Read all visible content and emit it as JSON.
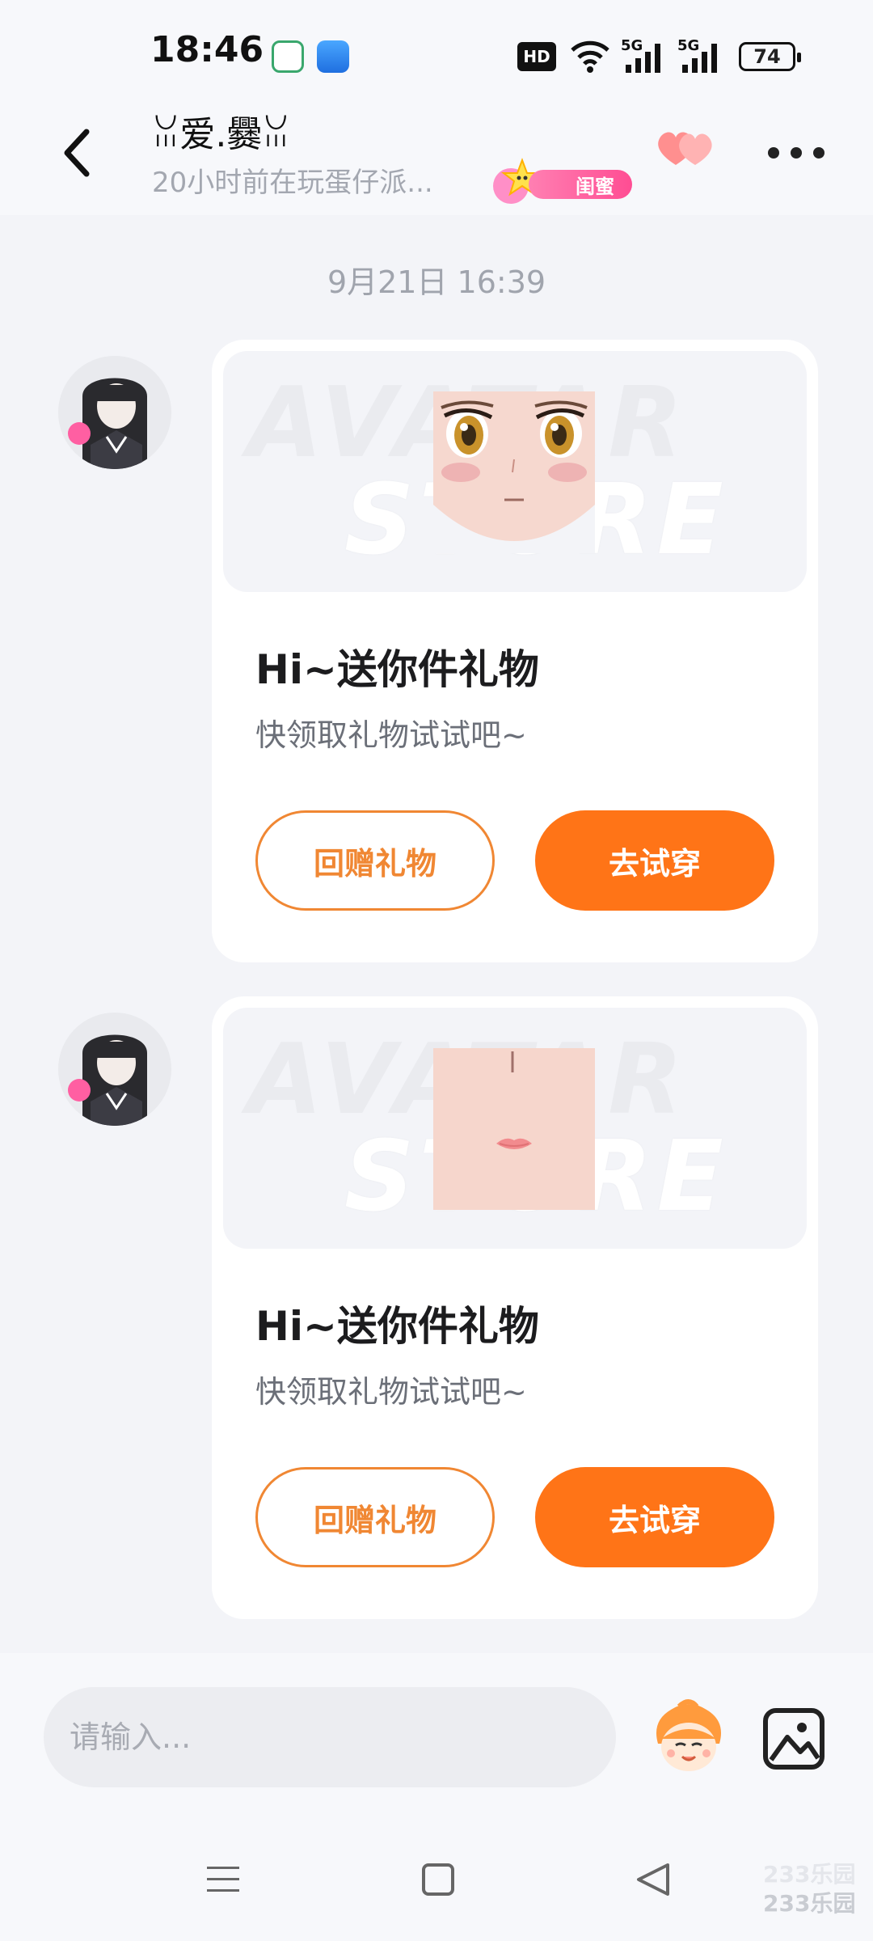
{
  "status_bar": {
    "time": "18:46",
    "hd_label": "HD",
    "signal_1": "5G",
    "signal_2": "5G",
    "battery": "74"
  },
  "header": {
    "name": "ꈍ爱.爨ꈍ",
    "status": "20小时前在玩蛋仔派...",
    "relation_badge": "闺蜜",
    "icons": [
      "back-arrow-icon",
      "star-icon",
      "hearts-icon",
      "more-icon"
    ]
  },
  "chat": {
    "date": "9月21日 16:39",
    "messages": [
      {
        "banner_watermark_1": "AVATAR",
        "banner_watermark_2": "STORE",
        "gift_item": "face",
        "title": "Hi~送你件礼物",
        "subtitle": "快领取礼物试试吧~",
        "return_gift_label": "回赠礼物",
        "try_on_label": "去试穿"
      },
      {
        "banner_watermark_1": "AVATAR",
        "banner_watermark_2": "STORE",
        "gift_item": "nose-lips",
        "title": "Hi~送你件礼物",
        "subtitle": "快领取礼物试试吧~",
        "return_gift_label": "回赠礼物",
        "try_on_label": "去试穿"
      }
    ]
  },
  "input": {
    "placeholder": "请输入..."
  },
  "watermark": {
    "top": "233乐园",
    "bottom": "233乐园"
  },
  "colors": {
    "accent": "#ff7417",
    "badge_pink": "#ff4d93",
    "background": "#f3f4f8"
  }
}
